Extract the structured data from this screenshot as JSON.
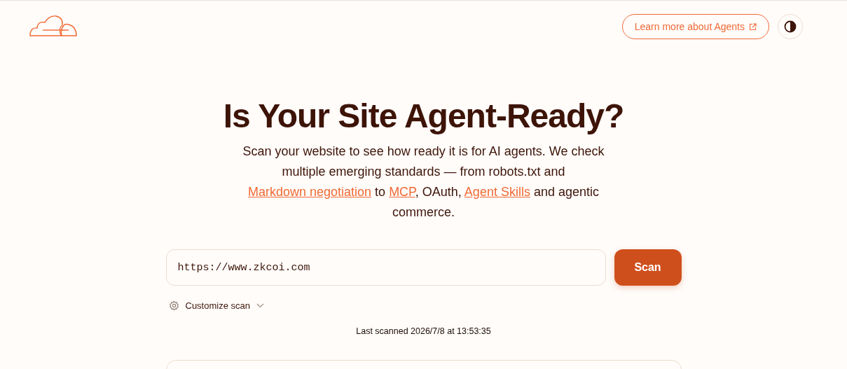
{
  "header": {
    "learn_more_button": {
      "label": "Learn more about Agents"
    }
  },
  "hero": {
    "title": "Is Your Site Agent-Ready?",
    "description": [
      {
        "kind": "text",
        "text": "Scan your website to see how ready it is for AI agents. We check multiple emerging standards — from robots.txt and "
      },
      {
        "kind": "link",
        "text": "Markdown negotiation"
      },
      {
        "kind": "text",
        "text": " to "
      },
      {
        "kind": "link",
        "text": "MCP"
      },
      {
        "kind": "text",
        "text": ", OAuth, "
      },
      {
        "kind": "link",
        "text": "Agent Skills"
      },
      {
        "kind": "text",
        "text": " and agentic commerce."
      }
    ]
  },
  "scan_form": {
    "url_field": {
      "value": "https://www.zkcoi.com"
    },
    "scan_button": {
      "label": "Scan"
    },
    "customize": {
      "label": "Customize scan",
      "expanded": false
    }
  },
  "last_scanned": "Last scanned 2026/7/8 at 13:53:35"
}
